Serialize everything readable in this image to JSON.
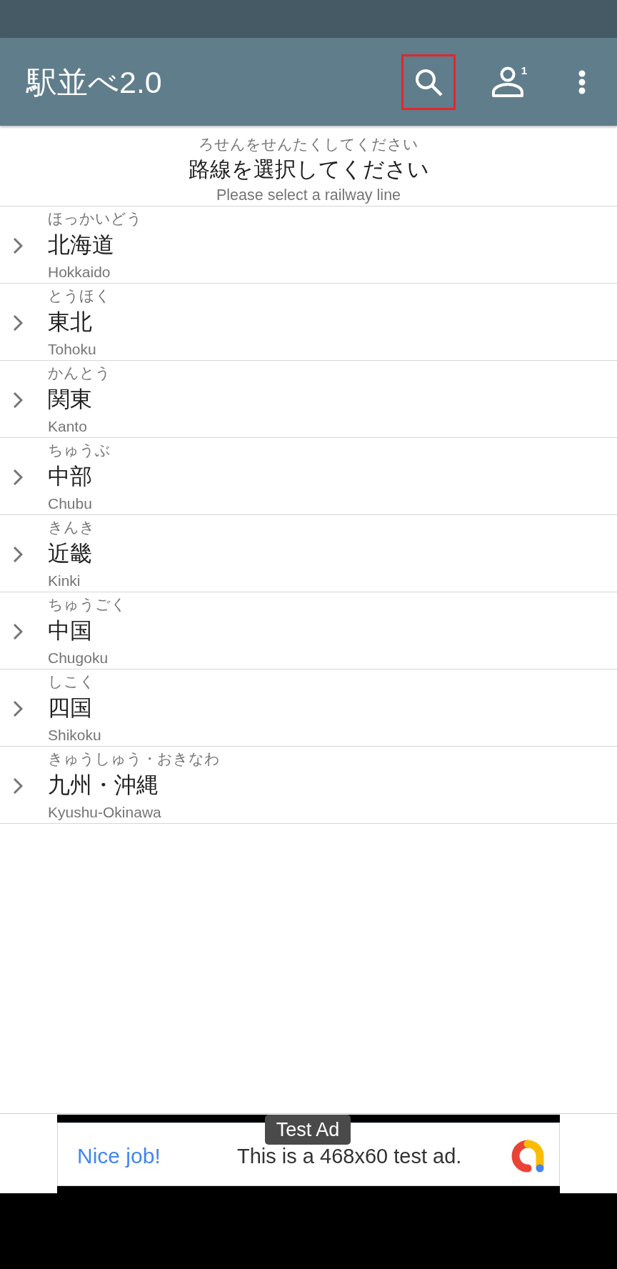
{
  "app_bar": {
    "title": "駅並べ2.0",
    "actions": [
      {
        "kind": "search",
        "highlighted": true
      },
      {
        "kind": "account",
        "badge": "1",
        "highlighted": false
      },
      {
        "kind": "more",
        "highlighted": false
      }
    ]
  },
  "header": {
    "reading": "ろせんをせんたくしてください",
    "title": "路線を選択してください",
    "subtitle": "Please select a railway line"
  },
  "regions": [
    {
      "reading": "ほっかいどう",
      "name": "北海道",
      "romaji": "Hokkaido"
    },
    {
      "reading": "とうほく",
      "name": "東北",
      "romaji": "Tohoku"
    },
    {
      "reading": "かんとう",
      "name": "関東",
      "romaji": "Kanto"
    },
    {
      "reading": "ちゅうぶ",
      "name": "中部",
      "romaji": "Chubu"
    },
    {
      "reading": "きんき",
      "name": "近畿",
      "romaji": "Kinki"
    },
    {
      "reading": "ちゅうごく",
      "name": "中国",
      "romaji": "Chugoku"
    },
    {
      "reading": "しこく",
      "name": "四国",
      "romaji": "Shikoku"
    },
    {
      "reading": "きゅうしゅう・おきなわ",
      "name": "九州・沖縄",
      "romaji": "Kyushu-Okinawa"
    }
  ],
  "ad": {
    "label": "Test Ad",
    "headline": "Nice job!",
    "text": "This is a 468x60 test ad."
  }
}
